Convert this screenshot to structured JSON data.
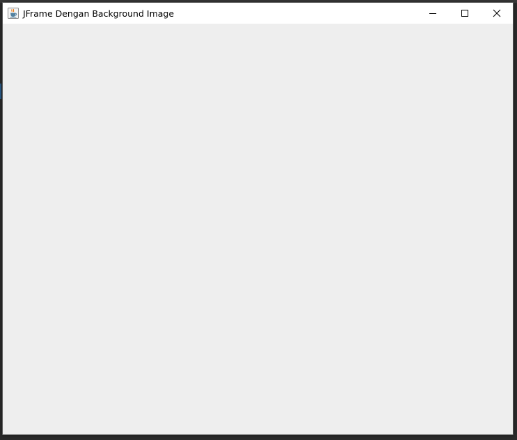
{
  "window": {
    "title": "JFrame Dengan Background Image",
    "app_icon": "java-coffee-cup-icon",
    "controls": {
      "minimize": "minimize-icon",
      "maximize": "maximize-icon",
      "close": "close-icon"
    }
  },
  "colors": {
    "titlebar": "#ffffff",
    "client_background": "#eeeeee",
    "desktop": "#2b2b2b"
  }
}
